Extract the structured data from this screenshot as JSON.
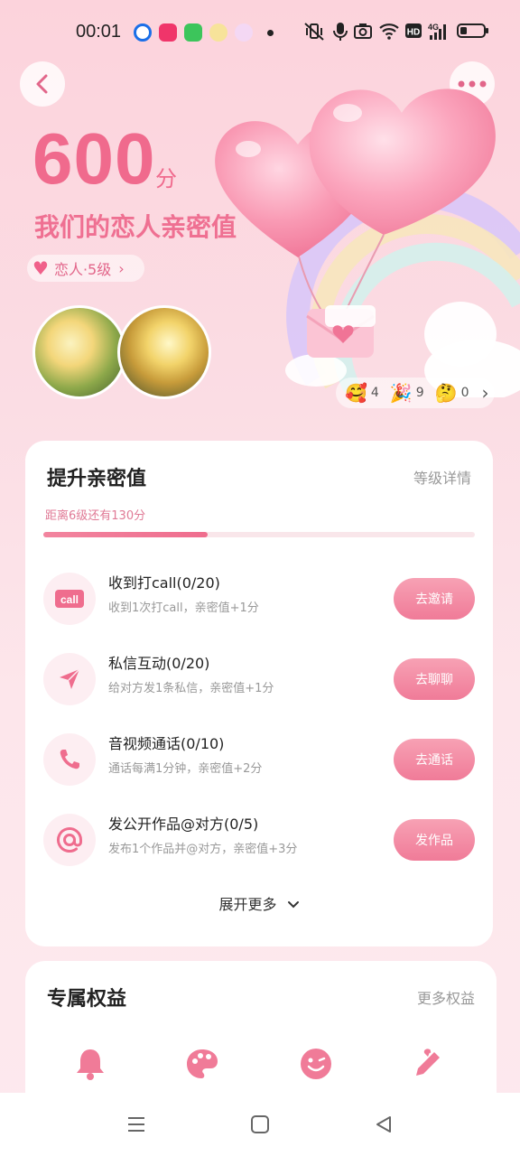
{
  "status": {
    "time": "00:01",
    "app_colors": [
      "#1a6fe8",
      "#f0356a",
      "#3cc55b",
      "#f2c13a",
      "#c27be8"
    ]
  },
  "header": {
    "back_icon": "chevron-left-icon",
    "more_icon": "more-dots-icon"
  },
  "hero": {
    "score": "600",
    "score_unit": "分",
    "title": "我们的恋人亲密值",
    "level_label": "恋人·5级",
    "reactions": [
      {
        "emoji": "🥰",
        "count": "4"
      },
      {
        "emoji": "🎉",
        "count": "9"
      },
      {
        "emoji": "🤔",
        "count": "0"
      }
    ]
  },
  "intimacy": {
    "title": "提升亲密值",
    "detail_link": "等级详情",
    "progress_text": "距离6级还有130分",
    "progress": 0.38,
    "tasks": [
      {
        "title": "收到打call(0/20)",
        "desc": "收到1次打call，亲密值+1分",
        "button": "去邀请",
        "icon": "call-icon"
      },
      {
        "title": "私信互动(0/20)",
        "desc": "给对方发1条私信，亲密值+1分",
        "button": "去聊聊",
        "icon": "send-icon"
      },
      {
        "title": "音视频通话(0/10)",
        "desc": "通话每满1分钟，亲密值+2分",
        "button": "去通话",
        "icon": "phone-icon"
      },
      {
        "title": "发公开作品@对方(0/5)",
        "desc": "发布1个作品并@对方，亲密值+3分",
        "button": "发作品",
        "icon": "at-icon"
      }
    ],
    "expand_label": "展开更多"
  },
  "benefits": {
    "title": "专属权益",
    "more_link": "更多权益",
    "icons": [
      "bell-icon",
      "palette-icon",
      "smile-icon",
      "pen-icon"
    ]
  },
  "colors": {
    "accent": "#f06a8d",
    "button": "#f07b98"
  }
}
